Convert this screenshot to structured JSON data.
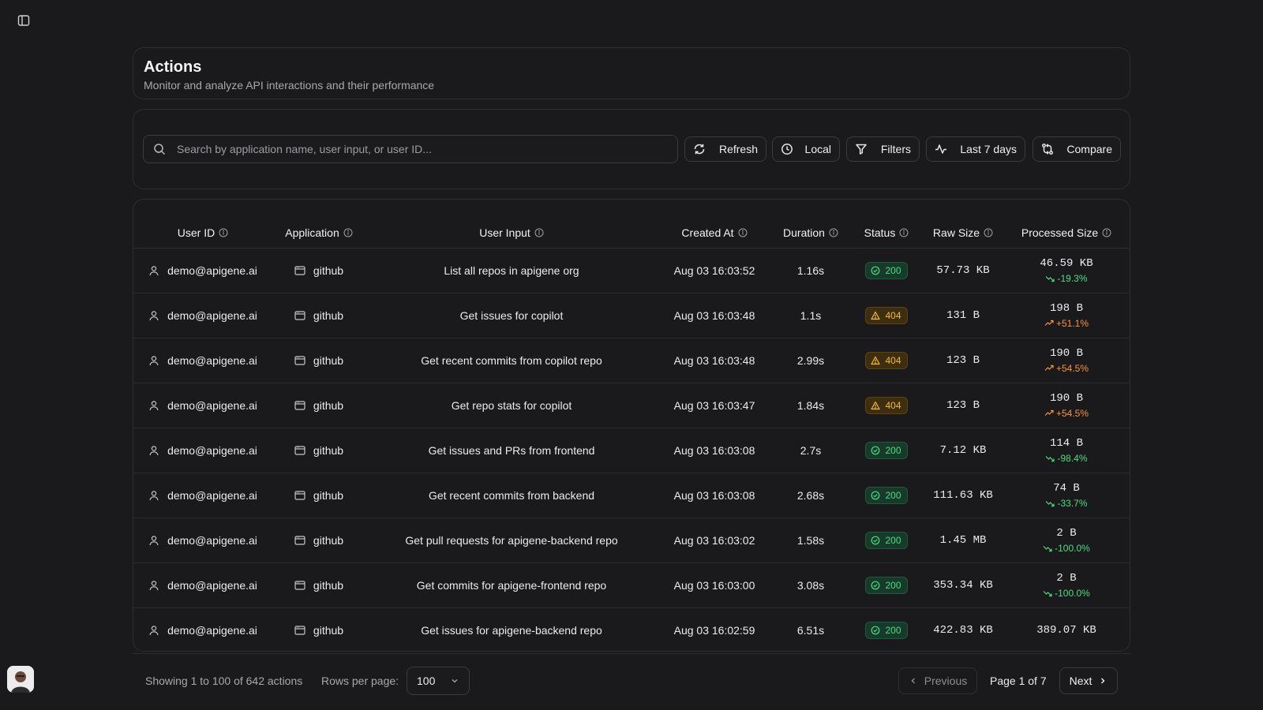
{
  "header": {
    "title": "Actions",
    "subtitle": "Monitor and analyze API interactions and their performance"
  },
  "toolbar": {
    "search_placeholder": "Search by application name, user input, or user ID...",
    "refresh_label": "Refresh",
    "timezone_label": "Local",
    "filters_label": "Filters",
    "range_label": "Last 7 days",
    "compare_label": "Compare"
  },
  "table": {
    "columns": [
      "User ID",
      "Application",
      "User Input",
      "Created At",
      "Duration",
      "Status",
      "Raw Size",
      "Processed Size"
    ],
    "rows": [
      {
        "user": "demo@apigene.ai",
        "app": "github",
        "input": "List all repos in apigene org",
        "created": "Aug 03 16:03:52",
        "duration": "1.16s",
        "status": "200",
        "raw": "57.73 KB",
        "processed": "46.59 KB",
        "delta": "-19.3%",
        "trend": "down"
      },
      {
        "user": "demo@apigene.ai",
        "app": "github",
        "input": "Get issues for copilot",
        "created": "Aug 03 16:03:48",
        "duration": "1.1s",
        "status": "404",
        "raw": "131 B",
        "processed": "198 B",
        "delta": "+51.1%",
        "trend": "up"
      },
      {
        "user": "demo@apigene.ai",
        "app": "github",
        "input": "Get recent commits from copilot repo",
        "created": "Aug 03 16:03:48",
        "duration": "2.99s",
        "status": "404",
        "raw": "123 B",
        "processed": "190 B",
        "delta": "+54.5%",
        "trend": "up"
      },
      {
        "user": "demo@apigene.ai",
        "app": "github",
        "input": "Get repo stats for copilot",
        "created": "Aug 03 16:03:47",
        "duration": "1.84s",
        "status": "404",
        "raw": "123 B",
        "processed": "190 B",
        "delta": "+54.5%",
        "trend": "up"
      },
      {
        "user": "demo@apigene.ai",
        "app": "github",
        "input": "Get issues and PRs from frontend",
        "created": "Aug 03 16:03:08",
        "duration": "2.7s",
        "status": "200",
        "raw": "7.12 KB",
        "processed": "114 B",
        "delta": "-98.4%",
        "trend": "down"
      },
      {
        "user": "demo@apigene.ai",
        "app": "github",
        "input": "Get recent commits from backend",
        "created": "Aug 03 16:03:08",
        "duration": "2.68s",
        "status": "200",
        "raw": "111.63 KB",
        "processed": "74 B",
        "delta": "-33.7%",
        "trend": "down"
      },
      {
        "user": "demo@apigene.ai",
        "app": "github",
        "input": "Get pull requests for apigene-backend repo",
        "created": "Aug 03 16:03:02",
        "duration": "1.58s",
        "status": "200",
        "raw": "1.45 MB",
        "processed": "2 B",
        "delta": "-100.0%",
        "trend": "down"
      },
      {
        "user": "demo@apigene.ai",
        "app": "github",
        "input": "Get commits for apigene-frontend repo",
        "created": "Aug 03 16:03:00",
        "duration": "3.08s",
        "status": "200",
        "raw": "353.34 KB",
        "processed": "2 B",
        "delta": "-100.0%",
        "trend": "down"
      },
      {
        "user": "demo@apigene.ai",
        "app": "github",
        "input": "Get issues for apigene-backend repo",
        "created": "Aug 03 16:02:59",
        "duration": "6.51s",
        "status": "200",
        "raw": "422.83 KB",
        "processed": "389.07 KB",
        "delta": "",
        "trend": "down"
      }
    ]
  },
  "footer": {
    "showing": "Showing 1 to 100 of 642 actions",
    "rows_per_page_label": "Rows per page:",
    "rows_per_page_value": "100",
    "previous_label": "Previous",
    "page_info": "Page 1 of 7",
    "next_label": "Next"
  },
  "colors": {
    "background": "#1a1a1c",
    "border": "#2f2f33",
    "success": "#4ade80",
    "warning": "#f5b82e",
    "increase": "#fb923c"
  },
  "icons": [
    "sidebar-toggle-icon",
    "search-icon",
    "refresh-icon",
    "clock-icon",
    "filter-icon",
    "activity-icon",
    "compare-icon",
    "info-icon",
    "user-icon",
    "app-window-icon",
    "check-circle-icon",
    "warning-triangle-icon",
    "trend-down-icon",
    "trend-up-icon",
    "chevron-down-icon",
    "chevron-left-icon",
    "chevron-right-icon"
  ]
}
